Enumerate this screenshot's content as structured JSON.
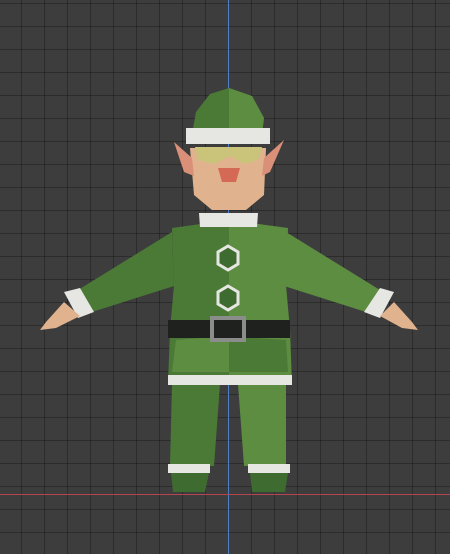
{
  "viewport": {
    "background": "#3d3d3d",
    "axis_z_color": "#4d7fc7",
    "axis_x_color": "#b2454d"
  },
  "model": {
    "suit_green": "#4b7a37",
    "suit_dark": "#3e6b2f",
    "suit_light": "#5c8d40",
    "trim_white": "#e6e6e2",
    "skin": "#e0b38e",
    "ear_pink": "#d98f78",
    "nose": "#d46a55",
    "belt": "#1f211f",
    "buckle": "#8a8d8a",
    "glasses": "#c9c47a"
  }
}
